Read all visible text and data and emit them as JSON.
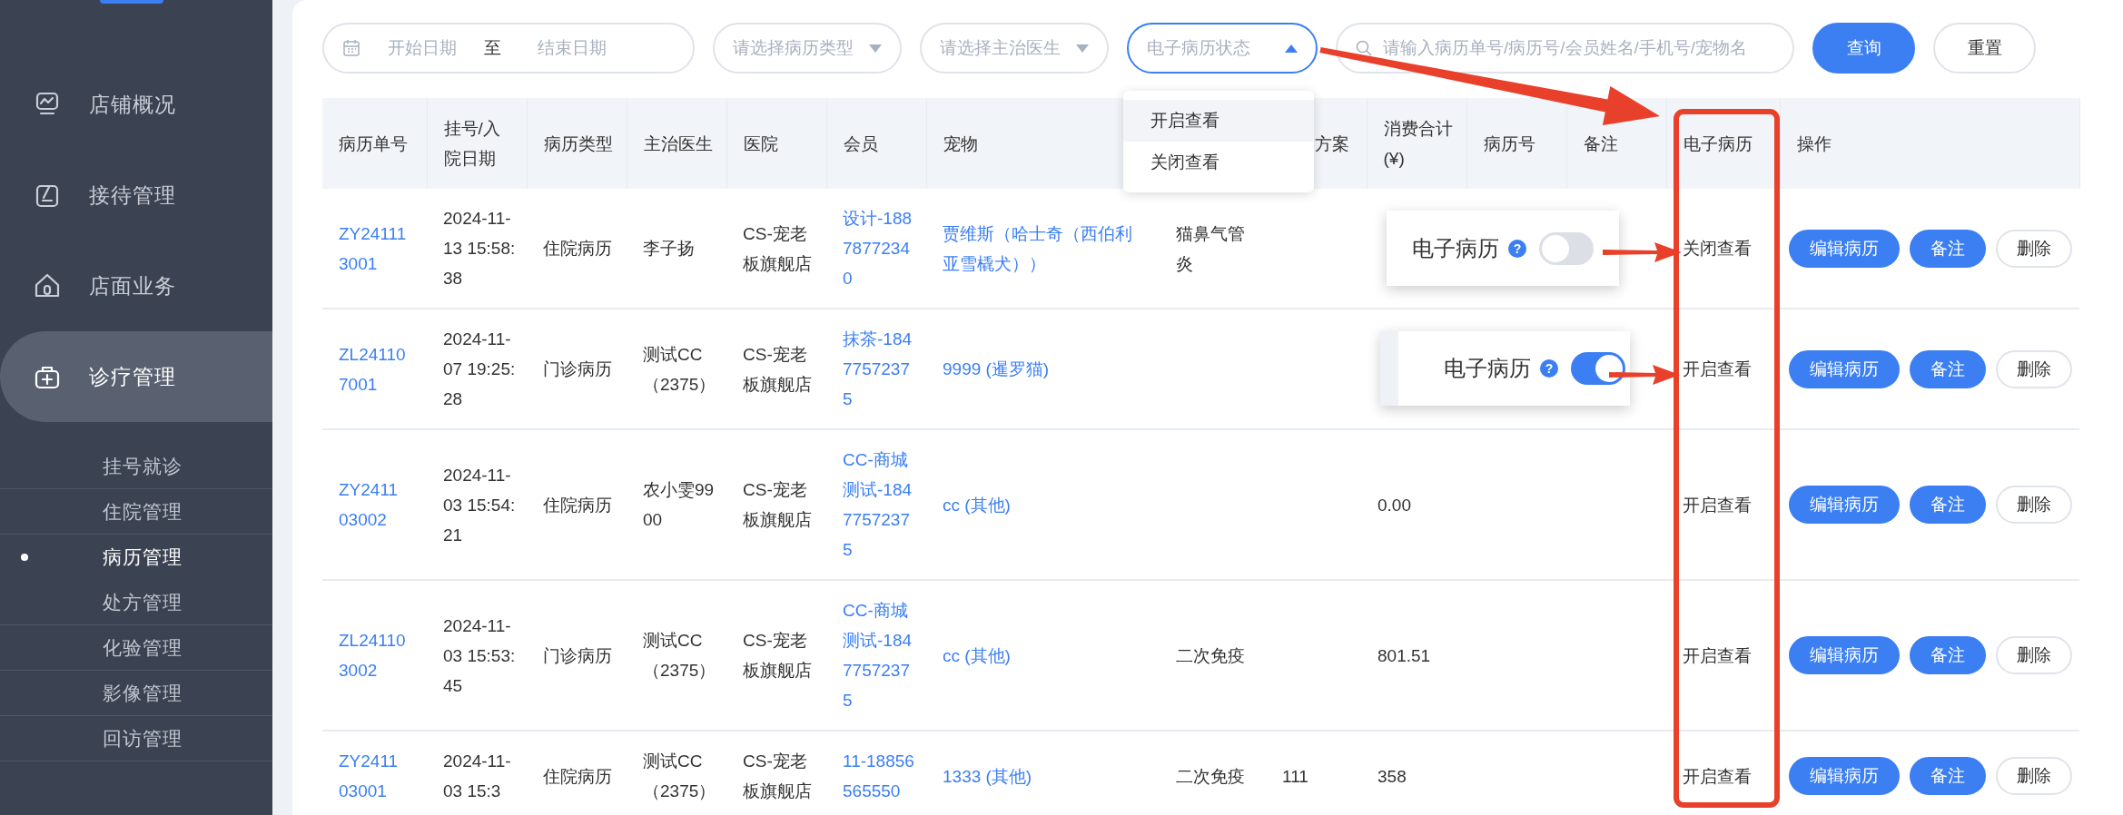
{
  "sidebar": {
    "items": [
      {
        "label": "店铺概况",
        "selected": false
      },
      {
        "label": "接待管理",
        "selected": false
      },
      {
        "label": "店面业务",
        "selected": false
      },
      {
        "label": "诊疗管理",
        "selected": true,
        "children": [
          {
            "label": "挂号就诊",
            "selected": false
          },
          {
            "label": "住院管理",
            "selected": false
          },
          {
            "label": "病历管理",
            "selected": true
          },
          {
            "label": "处方管理",
            "selected": false
          },
          {
            "label": "化验管理",
            "selected": false
          },
          {
            "label": "影像管理",
            "selected": false
          },
          {
            "label": "回访管理",
            "selected": false
          }
        ]
      }
    ]
  },
  "filters": {
    "date_range": {
      "start_placeholder": "开始日期",
      "separator": "至",
      "end_placeholder": "结束日期"
    },
    "selects": [
      {
        "placeholder": "请选择病历类型",
        "open": false
      },
      {
        "placeholder": "请选择主治医生",
        "open": false
      },
      {
        "placeholder": "电子病历状态",
        "open": true
      }
    ],
    "search": {
      "placeholder": "请输入病历单号/病历号/会员姓名/手机号/宠物名"
    },
    "buttons": [
      {
        "label": "查询",
        "kind": "primary"
      },
      {
        "label": "重置",
        "kind": "default"
      }
    ]
  },
  "dropdown": {
    "items": [
      {
        "label": "开启查看",
        "hovered": true
      },
      {
        "label": "关闭查看",
        "hovered": false
      }
    ]
  },
  "table": {
    "headers": {
      "record_no": "病历单号",
      "date": "挂号/入院日期",
      "type": "病历类型",
      "doctor": "主治医生",
      "hospital": "医院",
      "member": "会员",
      "pet": "宠物",
      "column_9": "方案",
      "total": "消费合计(¥)",
      "history_no": "病历号",
      "note": "备注",
      "e_record": "电子病历",
      "actions": "操作"
    },
    "rows": [
      {
        "record_no": "ZY241113001",
        "date": "2024-11-13 15:58:38",
        "type": "住院病历",
        "doctor": "李子扬",
        "hospital": "CS-宠老板旗舰店",
        "member": "设计-18878772340",
        "pet": "贾维斯（哈士奇（西伯利亚雪橇犬））",
        "column_8": "猫鼻气管炎",
        "e_record": "关闭查看",
        "actions": [
          {
            "label": "编辑病历",
            "kind": "primary"
          },
          {
            "label": "备注",
            "kind": "primary"
          },
          {
            "label": "删除",
            "kind": "default"
          }
        ]
      },
      {
        "record_no": "ZL241107001",
        "date": "2024-11-07 19:25:28",
        "type": "门诊病历",
        "doctor": "测试CC（2375）",
        "hospital": "CS-宠老板旗舰店",
        "member": "抹茶-18477572375",
        "pet": "9999 (暹罗猫)",
        "e_record": "开启查看",
        "actions": [
          {
            "label": "编辑病历",
            "kind": "primary"
          },
          {
            "label": "备注",
            "kind": "primary"
          },
          {
            "label": "删除",
            "kind": "default"
          }
        ]
      },
      {
        "record_no": "ZY241103002",
        "date": "2024-11-03 15:54:21",
        "type": "住院病历",
        "doctor": "农小雯9900",
        "hospital": "CS-宠老板旗舰店",
        "member": "CC-商城测试-18477572375",
        "pet": "cc (其他)",
        "total": "0.00",
        "e_record": "开启查看",
        "actions": [
          {
            "label": "编辑病历",
            "kind": "primary"
          },
          {
            "label": "备注",
            "kind": "primary"
          },
          {
            "label": "删除",
            "kind": "default"
          }
        ]
      },
      {
        "record_no": "ZL241103002",
        "date": "2024-11-03 15:53:45",
        "type": "门诊病历",
        "doctor": "测试CC（2375）",
        "hospital": "CS-宠老板旗舰店",
        "member": "CC-商城测试-18477572375",
        "pet": "cc (其他)",
        "column_8": "二次免疫",
        "total": "801.51",
        "e_record": "开启查看",
        "actions": [
          {
            "label": "编辑病历",
            "kind": "primary"
          },
          {
            "label": "备注",
            "kind": "primary"
          },
          {
            "label": "删除",
            "kind": "default"
          }
        ]
      },
      {
        "record_no": "ZY241103001",
        "date": "2024-11-03 15:3",
        "type": "住院病历",
        "doctor": "测试CC（2375）",
        "hospital": "CS-宠老板旗舰店",
        "member": "11-18856565550",
        "pet": "1333 (其他)",
        "column_8": "二次免疫",
        "column_9": "111",
        "total": "358",
        "e_record": "开启查看",
        "actions": [
          {
            "label": "编辑病历",
            "kind": "primary"
          },
          {
            "label": "备注",
            "kind": "primary"
          },
          {
            "label": "删除",
            "kind": "default"
          }
        ]
      }
    ]
  },
  "callouts": [
    {
      "label": "电子病历",
      "help_icon": "?",
      "on": false
    },
    {
      "label": "电子病历",
      "help_icon": "?",
      "on": true
    }
  ]
}
